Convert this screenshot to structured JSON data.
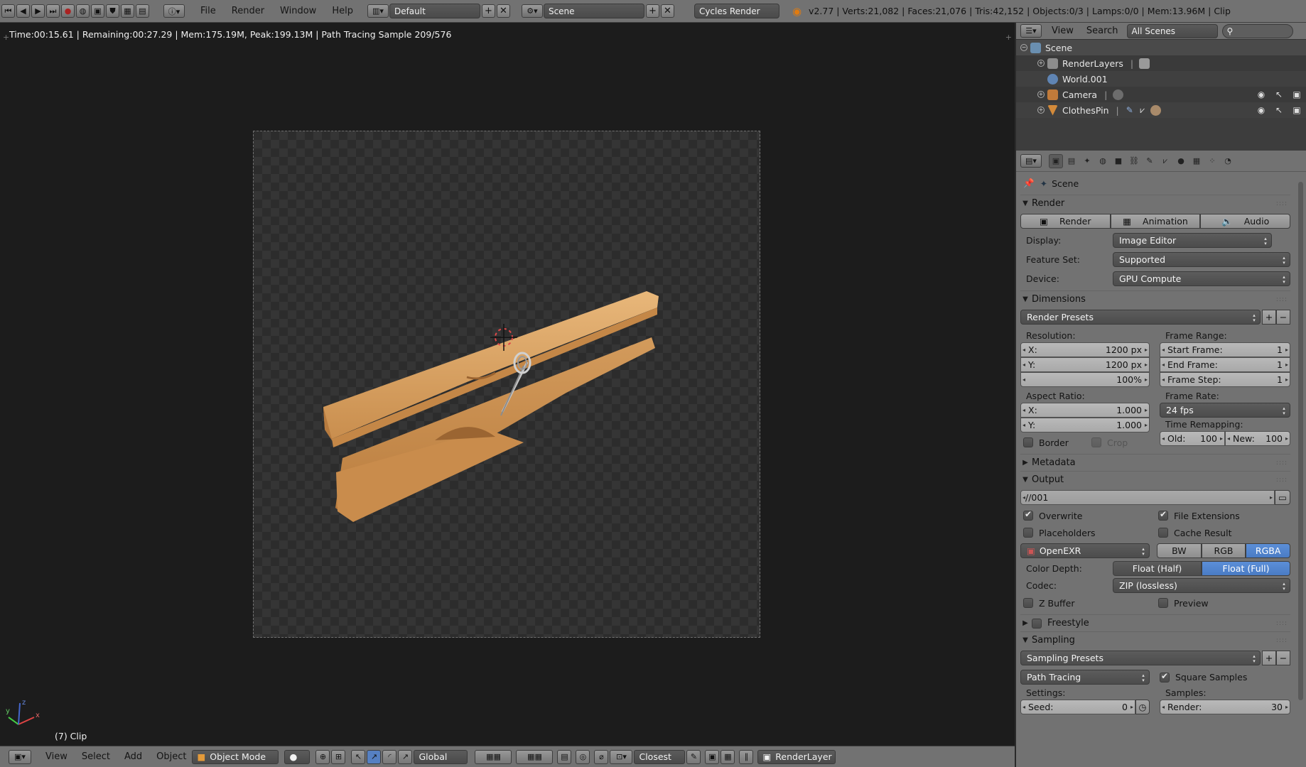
{
  "header": {
    "menus": [
      "File",
      "Render",
      "Window",
      "Help"
    ],
    "screen_layout": "Default",
    "scene": "Scene",
    "engine": "Cycles Render",
    "stats": "v2.77 | Verts:21,082 | Faces:21,076 | Tris:42,152 | Objects:0/3 | Lamps:0/0 | Mem:13.96M | Clip"
  },
  "viewport": {
    "info": "Time:00:15.61 | Remaining:00:27.29 | Mem:175.19M, Peak:199.13M | Path Tracing Sample 209/576",
    "object_label": "(7) Clip",
    "axis_x": "x",
    "axis_y": "y",
    "axis_z": "z"
  },
  "footer": {
    "view": "View",
    "select": "Select",
    "add": "Add",
    "object": "Object",
    "mode": "Object Mode",
    "orientation": "Global",
    "snap": "Closest",
    "render_layer": "RenderLayer"
  },
  "outliner": {
    "view": "View",
    "search": "Search",
    "filter": "All Scenes",
    "items": [
      {
        "label": "Scene"
      },
      {
        "label": "RenderLayers"
      },
      {
        "label": "World.001"
      },
      {
        "label": "Camera"
      },
      {
        "label": "ClothesPin"
      }
    ]
  },
  "properties": {
    "context": "Scene",
    "render": {
      "title": "Render",
      "buttons": [
        "Render",
        "Animation",
        "Audio"
      ],
      "display_label": "Display:",
      "display_value": "Image Editor",
      "feature_label": "Feature Set:",
      "feature_value": "Supported",
      "device_label": "Device:",
      "device_value": "GPU Compute"
    },
    "dimensions": {
      "title": "Dimensions",
      "presets": "Render Presets",
      "resolution_label": "Resolution:",
      "res_x_label": "X:",
      "res_x": "1200 px",
      "res_y_label": "Y:",
      "res_y": "1200 px",
      "res_pct": "100%",
      "frame_range_label": "Frame Range:",
      "start_label": "Start Frame:",
      "start": "1",
      "end_label": "End Frame:",
      "end": "1",
      "step_label": "Frame Step:",
      "step": "1",
      "aspect_label": "Aspect Ratio:",
      "asp_x_label": "X:",
      "asp_x": "1.000",
      "asp_y_label": "Y:",
      "asp_y": "1.000",
      "frame_rate_label": "Frame Rate:",
      "frame_rate": "24 fps",
      "time_remap_label": "Time Remapping:",
      "old_label": "Old:",
      "old": "100",
      "new_label": "New:",
      "new": "100",
      "border": "Border",
      "crop": "Crop"
    },
    "metadata": {
      "title": "Metadata"
    },
    "output": {
      "title": "Output",
      "path": "//001",
      "overwrite": "Overwrite",
      "file_extensions": "File Extensions",
      "placeholders": "Placeholders",
      "cache_result": "Cache Result",
      "format": "OpenEXR",
      "channels": [
        "BW",
        "RGB",
        "RGBA"
      ],
      "color_depth_label": "Color Depth:",
      "depths": [
        "Float (Half)",
        "Float (Full)"
      ],
      "codec_label": "Codec:",
      "codec": "ZIP (lossless)",
      "z_buffer": "Z Buffer",
      "preview": "Preview"
    },
    "freestyle": {
      "title": "Freestyle"
    },
    "sampling": {
      "title": "Sampling",
      "presets": "Sampling Presets",
      "integrator": "Path Tracing",
      "square_samples": "Square Samples",
      "settings_label": "Settings:",
      "samples_label": "Samples:",
      "seed_label": "Seed:",
      "seed": "0",
      "render_label": "Render:",
      "render": "30"
    }
  },
  "colors": {
    "accent": "#5680c2",
    "header_bg": "#727272",
    "viewport_bg": "#1c1c1c",
    "wood": "#d9a161"
  }
}
